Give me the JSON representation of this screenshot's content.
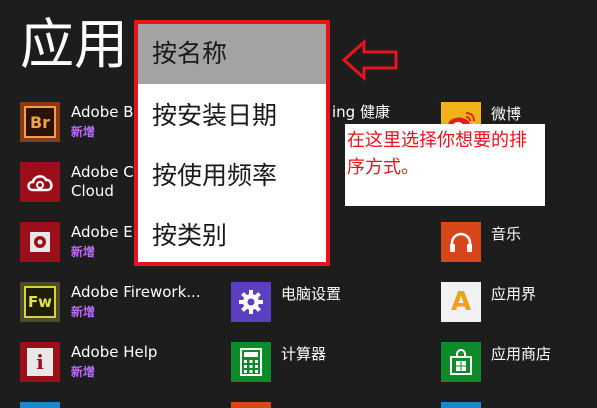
{
  "page": {
    "title": "应用"
  },
  "sort_menu": {
    "items": [
      {
        "label": "按名称",
        "selected": true
      },
      {
        "label": "按安装日期",
        "selected": false
      },
      {
        "label": "按使用频率",
        "selected": false
      },
      {
        "label": "按类别",
        "selected": false
      }
    ]
  },
  "annotation": {
    "note": "在这里选择你想要的排序方式。"
  },
  "badge_color": "#b46cf0",
  "apps": [
    {
      "name": "Adobe B",
      "badge": "新增",
      "icon": "br-logo-icon",
      "icon_text": "Br",
      "tile_color": "#8a3b12"
    },
    {
      "name": "Adobe C",
      "name_line2": "Cloud",
      "icon": "creative-cloud-icon",
      "tile_color": "#9c0f1a"
    },
    {
      "name": "Adobe E",
      "badge": "新增",
      "icon": "adobe-extension-icon",
      "tile_color": "#9c0f1a"
    },
    {
      "name": "Adobe Firework...",
      "badge": "新增",
      "icon": "fw-logo-icon",
      "icon_text": "Fw",
      "tile_color": "#4b4a2a"
    },
    {
      "name": "Adobe Help",
      "badge": "新增",
      "icon": "info-icon",
      "icon_text": "i",
      "tile_color": "#9c0f1a"
    },
    {
      "name": "ing 健康",
      "icon": "health-icon",
      "tile_color": "#1d1d1d"
    },
    {
      "name": "电脑设置",
      "icon": "gear-icon",
      "tile_color": "#5a3fc0"
    },
    {
      "name": "计算器",
      "icon": "calculator-icon",
      "tile_color": "#0d8a2a"
    },
    {
      "name": "微博",
      "icon": "weibo-icon",
      "tile_color": "#f2b21a"
    },
    {
      "name": "音乐",
      "icon": "headphones-icon",
      "tile_color": "#d8461b"
    },
    {
      "name": "应用界",
      "icon": "letter-a-icon",
      "icon_text": "A",
      "tile_color": "#f2f2f2"
    },
    {
      "name": "应用商店",
      "icon": "store-icon",
      "tile_color": "#0d8a2a"
    }
  ]
}
